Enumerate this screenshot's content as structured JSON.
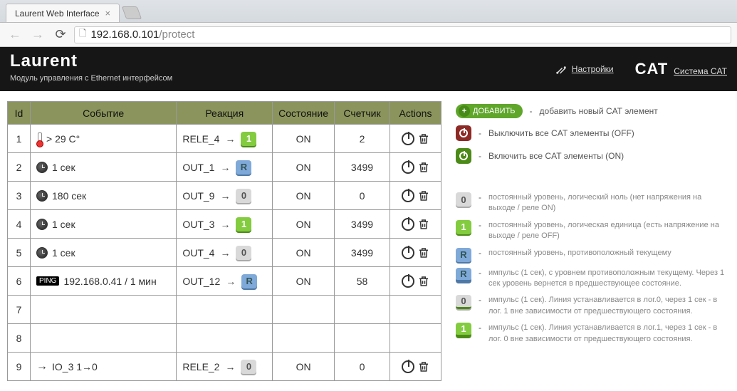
{
  "browser": {
    "tab_title": "Laurent Web Interface",
    "url_host": "192.168.0.101",
    "url_path": "/protect"
  },
  "header": {
    "brand": "Laurent",
    "subtitle": "Mодуль управления с Ethernet интерфейсом",
    "settings_link": "Настройки",
    "cat_logo": "CAT",
    "cat_link": "Система CAT"
  },
  "table": {
    "columns": {
      "id": "Id",
      "event": "Событие",
      "reaction": "Реакция",
      "state": "Состояние",
      "counter": "Счетчик",
      "actions": "Actions"
    },
    "rows": [
      {
        "id": "1",
        "event": {
          "icon": "therm",
          "text": "> 29 C°"
        },
        "react": {
          "name": "RELE_4",
          "pill": {
            "t": "1",
            "c": "green"
          }
        },
        "state": "ON",
        "counter": "2"
      },
      {
        "id": "2",
        "event": {
          "icon": "clock",
          "text": "1 сек"
        },
        "react": {
          "name": "OUT_1",
          "pill": {
            "t": "R",
            "c": "blue"
          }
        },
        "state": "ON",
        "counter": "3499"
      },
      {
        "id": "3",
        "event": {
          "icon": "clock",
          "text": "180 сек"
        },
        "react": {
          "name": "OUT_9",
          "pill": {
            "t": "0",
            "c": "gray"
          }
        },
        "state": "ON",
        "counter": "0"
      },
      {
        "id": "4",
        "event": {
          "icon": "clock",
          "text": "1 сек"
        },
        "react": {
          "name": "OUT_3",
          "pill": {
            "t": "1",
            "c": "green"
          }
        },
        "state": "ON",
        "counter": "3499"
      },
      {
        "id": "5",
        "event": {
          "icon": "clock",
          "text": "1 сек"
        },
        "react": {
          "name": "OUT_4",
          "pill": {
            "t": "0",
            "c": "gray"
          }
        },
        "state": "ON",
        "counter": "3499"
      },
      {
        "id": "6",
        "event": {
          "icon": "ping",
          "text": "192.168.0.41 / 1 мин"
        },
        "react": {
          "name": "OUT_12",
          "pill": {
            "t": "R",
            "c": "blue"
          }
        },
        "state": "ON",
        "counter": "58"
      },
      {
        "id": "7"
      },
      {
        "id": "8"
      },
      {
        "id": "9",
        "event": {
          "icon": "io",
          "text": "IO_3   1→0"
        },
        "react": {
          "name": "RELE_2",
          "pill": {
            "t": "0",
            "c": "gray"
          }
        },
        "state": "ON",
        "counter": "0"
      }
    ]
  },
  "sidebar": {
    "add_label": "ДОБАВИТЬ",
    "add_desc": "добавить новый CAT элемент",
    "off_desc": "Выключить все CAT элементы (OFF)",
    "on_desc": "Включить все CAT элементы (ON)",
    "legend": [
      {
        "pill": {
          "t": "0",
          "c": "gray"
        },
        "text": "постоянный уровень, логический ноль (нет напряжения на выходе / реле ON)"
      },
      {
        "pill": {
          "t": "1",
          "c": "green"
        },
        "text": "постоянный уровень, логическая единица (есть напряжение на выходе / реле OFF)"
      },
      {
        "pill": {
          "t": "R",
          "c": "blue"
        },
        "text": "постоянный уровень, противоположный текущему"
      },
      {
        "pill": {
          "t": "R",
          "c": "blue",
          "ul": "blue"
        },
        "text": "импульс (1 сек), с уровнем противоположным текущему. Через 1 сек уровень вернется в предшествующее состояние."
      },
      {
        "pill": {
          "t": "0",
          "c": "gray",
          "ul": "green"
        },
        "text": "импульс (1 сек). Линия устанавливается в лог.0, через 1 сек - в лог. 1 вне зависимости от предшествующего состояния."
      },
      {
        "pill": {
          "t": "1",
          "c": "green",
          "ul": "green"
        },
        "text": "импульс (1 сек). Линия устанавливается в лог.1, через 1 сек - в лог. 0 вне зависимости от предшествующего состояния."
      }
    ]
  },
  "misc": {
    "ping_label": "PING",
    "dash": "-"
  }
}
